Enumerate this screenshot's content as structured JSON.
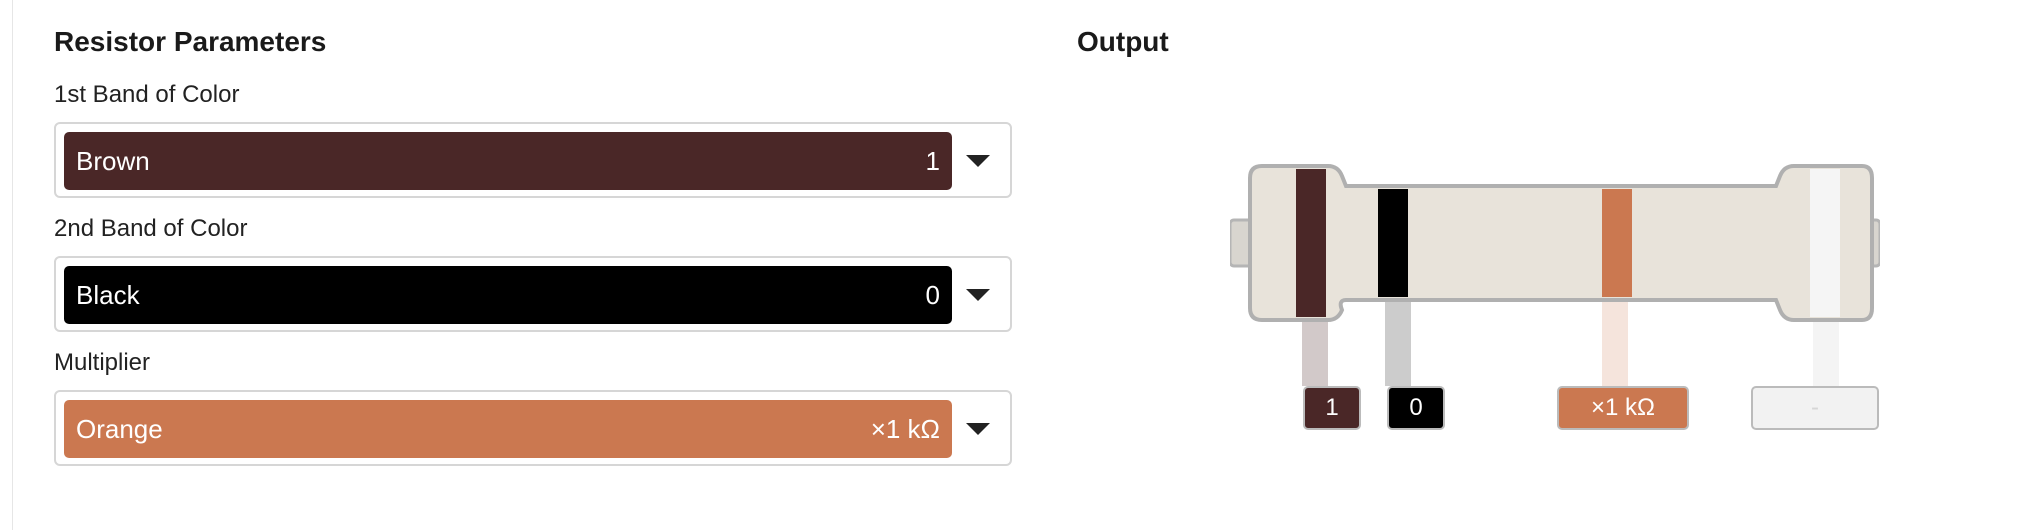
{
  "panel": {
    "title": "Resistor Parameters",
    "fields": [
      {
        "label": "1st Band of Color",
        "color_name": "Brown",
        "value": "1",
        "color": "#4a2727"
      },
      {
        "label": "2nd Band of Color",
        "color_name": "Black",
        "value": "0",
        "color": "#000000"
      },
      {
        "label": "Multiplier",
        "color_name": "Orange",
        "value": "×1 kΩ",
        "color": "#cb7850"
      }
    ]
  },
  "output": {
    "title": "Output",
    "tags": [
      {
        "text": "1",
        "color": "#4a2727"
      },
      {
        "text": "0",
        "color": "#000000"
      },
      {
        "text": "×1 kΩ",
        "color": "#cb7850"
      },
      {
        "text": "-",
        "color": "#f2f2f2"
      }
    ],
    "body_color": "#e8e3da",
    "tolerance_band_color": "#f5f5f5"
  }
}
